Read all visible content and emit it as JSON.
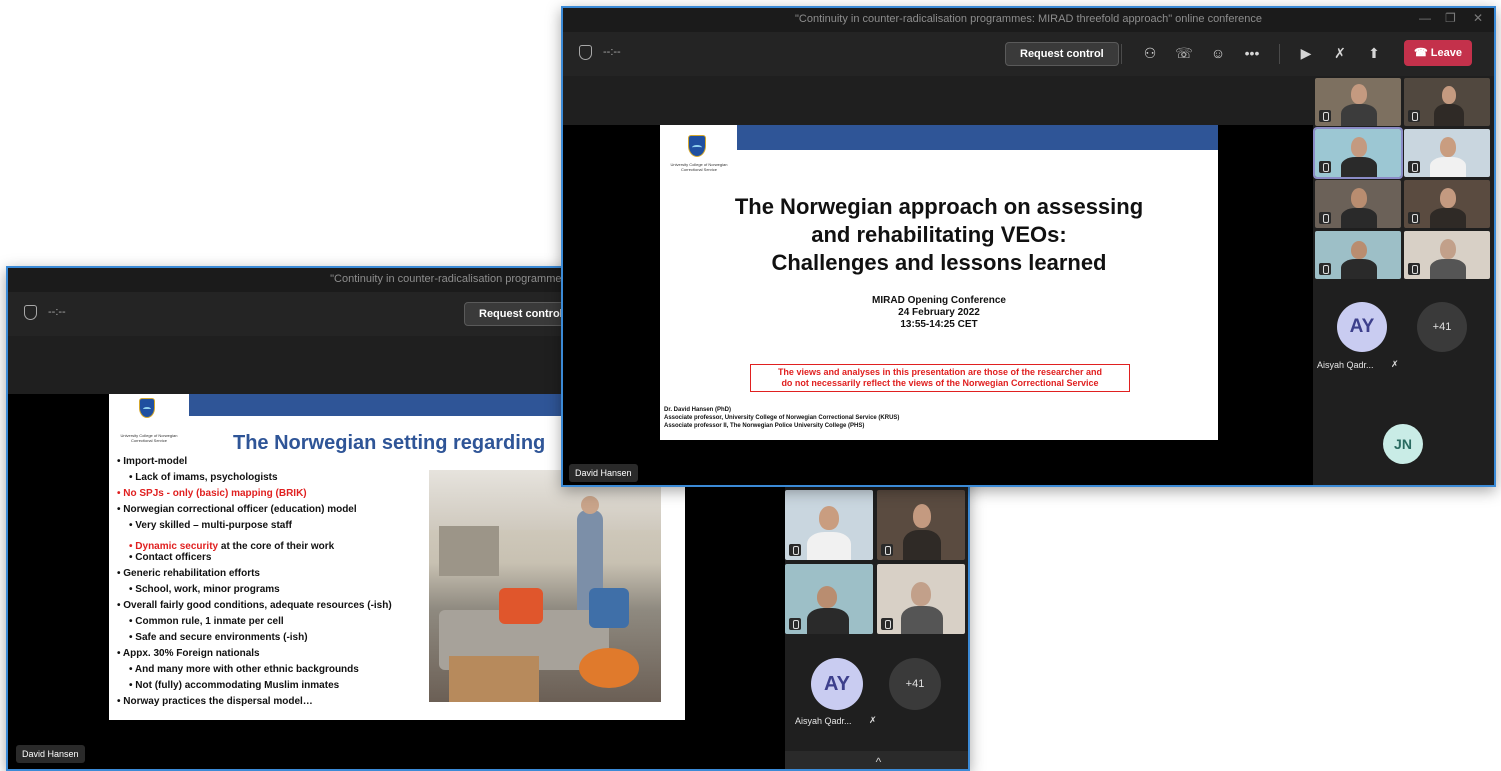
{
  "window_title": "\"Continuity in counter-radicalisation programmes: MIRAD threefold approach\" online conference",
  "back_window_title": "\"Continuity in counter-radicalisation programmes: MIRAD threefo",
  "timer": "--:--",
  "request_control": "Request control",
  "leave_label": "Leave",
  "presenter": "David Hansen",
  "college_name": "University College of Norwegian Correctional Service",
  "front_slide": {
    "title_line1": "The Norwegian approach on assessing",
    "title_line2": "and rehabilitating VEOs:",
    "title_line3": "Challenges and lessons learned",
    "event": "MIRAD Opening Conference",
    "date": "24 February 2022",
    "time": "13:55-14:25 CET",
    "disclaimer_line1": "The views and analyses in this presentation are those of the researcher and",
    "disclaimer_line2": "do not necessarily reflect the views of the Norwegian Correctional Service",
    "author": "Dr. David Hansen (PhD)",
    "affil1": "Associate professor, University College of Norwegian Correctional Service (KRUS)",
    "affil2": "Associate professor II, The Norwegian Police University College (PHS)"
  },
  "back_slide": {
    "title": "The Norwegian setting regarding",
    "bullets": [
      "•  Import-model",
      "•  Lack of imams, psychologists",
      "•  No SPJs  - only (basic) mapping (BRIK)",
      "•  Norwegian correctional officer (education) model",
      "•  Very skilled – multi-purpose staff",
      "•  Dynamic security",
      " at the core of their work",
      "•  Contact officers",
      "•  Generic rehabilitation efforts",
      "•  School, work, minor programs",
      "•  Overall fairly good conditions, adequate resources (-ish)",
      "•  Common rule, 1 inmate per cell",
      "•  Safe and secure environments (-ish)",
      "•  Appx. 30% Foreign nationals",
      "•  And many more with other ethnic backgrounds",
      "•  Not (fully) accommodating Muslim inmates",
      "•  Norway practices the dispersal model…"
    ]
  },
  "participants": {
    "avatar_ay": "AY",
    "overflow": "+41",
    "ay_name": "Aisyah Qadr...",
    "avatar_jn": "JN"
  },
  "colors": {
    "teams_dark": "#1f1f1f",
    "leave_red": "#c4314b",
    "window_border": "#3b8ad6",
    "slide_blue": "#2f5597"
  }
}
